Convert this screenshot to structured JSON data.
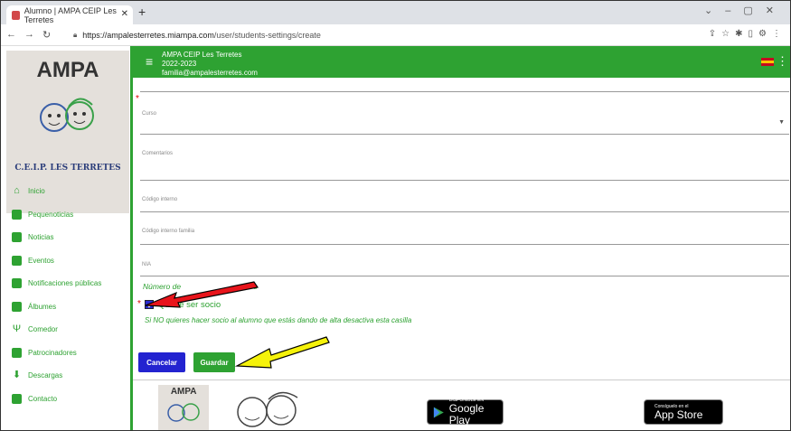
{
  "browser": {
    "tab_title": "Alumno | AMPA CEIP Les Terretes",
    "url_host": "https://ampalesterretes.miampa.com",
    "url_path": "/user/students-settings/create"
  },
  "header": {
    "org_name": "AMPA CEIP Les Terretes",
    "year": "2022-2023",
    "email": "familia@ampalesterretes.com"
  },
  "sidebar": {
    "logo_title": "AMPA",
    "logo_subtitle": "C.E.I.P. LES TERRETES",
    "items": [
      {
        "label": "Inicio",
        "icon": "home-icon"
      },
      {
        "label": "Pequenoticias",
        "icon": "news-icon"
      },
      {
        "label": "Noticias",
        "icon": "news-icon"
      },
      {
        "label": "Eventos",
        "icon": "calendar-icon"
      },
      {
        "label": "Notificaciones públicas",
        "icon": "message-icon"
      },
      {
        "label": "Álbumes",
        "icon": "photo-icon"
      },
      {
        "label": "Comedor",
        "icon": "cutlery-icon"
      },
      {
        "label": "Patrocinadores",
        "icon": "store-icon"
      },
      {
        "label": "Descargas",
        "icon": "download-icon"
      },
      {
        "label": "Contacto",
        "icon": "contact-icon"
      }
    ]
  },
  "form": {
    "curso_label": "Curso",
    "comentarios_label": "Comentarios",
    "codigo_interno_label": "Código interno",
    "codigo_familia_label": "Código interno familia",
    "nia_label": "NIA",
    "socio_hint_prefix": "Número",
    "socio_hint_mid": "de",
    "socio_hint_suffix": "o",
    "checkbox_label": "Quiere ser socio",
    "checkbox_checked": true,
    "help_text": "Si NO quieres hacer socio al alumno que estás dando de alta desactiva esta casilla",
    "cancel_label": "Cancelar",
    "save_label": "Guardar"
  },
  "footer": {
    "logo_text": "AMPA",
    "google_small": "DISPONIBLE EN",
    "google_big": "Google Play",
    "apple_small": "Consíguelo en el",
    "apple_big": "App Store"
  },
  "annotations": {
    "red_arrow_color": "#e8141b",
    "yellow_arrow_color": "#f5f20a"
  }
}
